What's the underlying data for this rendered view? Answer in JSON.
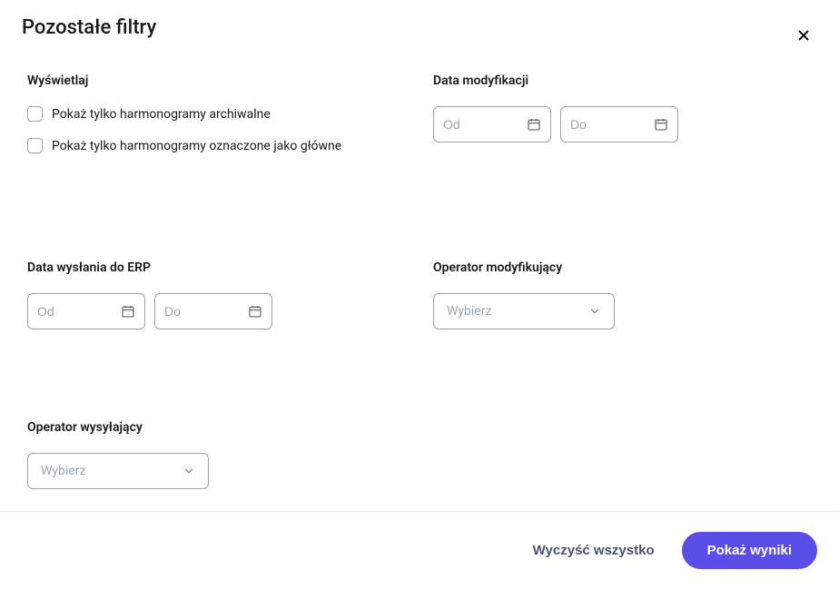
{
  "header": {
    "title": "Pozostałe filtry"
  },
  "filters": {
    "display": {
      "label": "Wyświetlaj",
      "checkbox_archival": "Pokaż tylko harmonogramy archiwalne",
      "checkbox_main": "Pokaż tylko harmonogramy oznaczone jako główne"
    },
    "modification_date": {
      "label": "Data modyfikacji",
      "from_placeholder": "Od",
      "to_placeholder": "Do"
    },
    "erp_sent_date": {
      "label": "Data wysłania do ERP",
      "from_placeholder": "Od",
      "to_placeholder": "Do"
    },
    "modifying_operator": {
      "label": "Operator modyfikujący",
      "placeholder": "Wybierz"
    },
    "sending_operator": {
      "label": "Operator wysyłający",
      "placeholder": "Wybierz"
    }
  },
  "footer": {
    "clear_label": "Wyczyść wszystko",
    "submit_label": "Pokaż wyniki"
  }
}
